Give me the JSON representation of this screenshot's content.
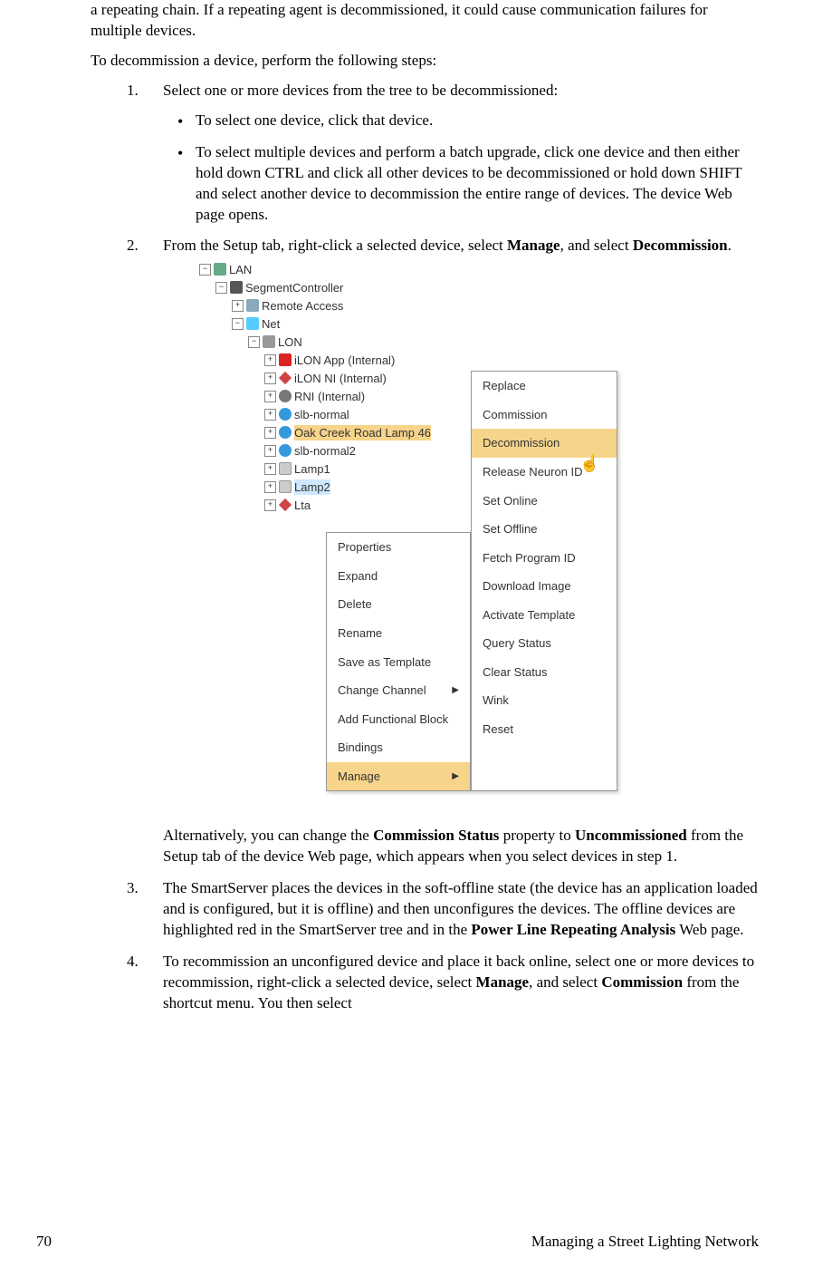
{
  "para_top1": "a repeating chain.  If a repeating agent is decommissioned, it could cause communication failures for multiple devices.",
  "para_top2": "To decommission a device, perform the following steps:",
  "steps": {
    "s1": {
      "num": "1.",
      "text": "Select one or more devices from the tree to be decommissioned:",
      "b1": "To select one device, click that device.",
      "b2": "To select multiple devices and perform a batch upgrade, click one device and then either hold down CTRL and click all other devices to be decommissioned or hold down SHIFT and select another device to decommission the entire range of devices.  The device Web page opens."
    },
    "s2": {
      "num": "2.",
      "pre": "From the Setup tab, right-click a selected device, select ",
      "b1": "Manage",
      "mid": ", and select ",
      "b2": "Decommission",
      "post": "."
    },
    "alt": {
      "pre": "Alternatively, you can change the ",
      "b1": "Commission Status",
      "mid": " property to ",
      "b2": "Uncommissioned",
      "post": " from the Setup tab of the device Web page, which appears when you select devices in step 1."
    },
    "s3": {
      "num": "3.",
      "pre": "The SmartServer places the devices in the soft-offline state (the device has an application loaded and is configured, but it is offline) and then unconfigures the devices.  The offline devices are highlighted red in the SmartServer tree and in the ",
      "b1": "Power Line Repeating Analysis",
      "post": " Web page."
    },
    "s4": {
      "num": "4.",
      "pre": "To recommission an unconfigured device and place it back online, select one or more devices to recommission, right-click a selected device, select ",
      "b1": "Manage",
      "mid": ", and select ",
      "b2": "Commission",
      "post": " from the shortcut menu.  You then select"
    }
  },
  "tree": {
    "lan": "LAN",
    "seg": "SegmentController",
    "remote": "Remote Access",
    "net": "Net",
    "lon": "LON",
    "n1": "iLON App (Internal)",
    "n2": "iLON NI (Internal)",
    "n3": "RNI (Internal)",
    "n4": "slb-normal",
    "n5": "Oak Creek Road Lamp 46",
    "n6": "slb-normal2",
    "n7": "Lamp1",
    "n8": "Lamp2",
    "n9": "Lta"
  },
  "menu1": {
    "m1": "Properties",
    "m2": "Expand",
    "m3": "Delete",
    "m4": "Rename",
    "m5": "Save as Template",
    "m6": "Change Channel",
    "m7": "Add Functional Block",
    "m8": "Bindings",
    "m9": "Manage"
  },
  "menu2": {
    "m1": "Replace",
    "m2": "Commission",
    "m3": "Decommission",
    "m4": "Release Neuron ID",
    "m5": "Set Online",
    "m6": "Set Offline",
    "m7": "Fetch Program ID",
    "m8": "Download Image",
    "m9": "Activate Template",
    "m10": "Query Status",
    "m11": "Clear Status",
    "m12": "Wink",
    "m13": "Reset"
  },
  "footer": {
    "page": "70",
    "title": "Managing a Street Lighting Network"
  }
}
